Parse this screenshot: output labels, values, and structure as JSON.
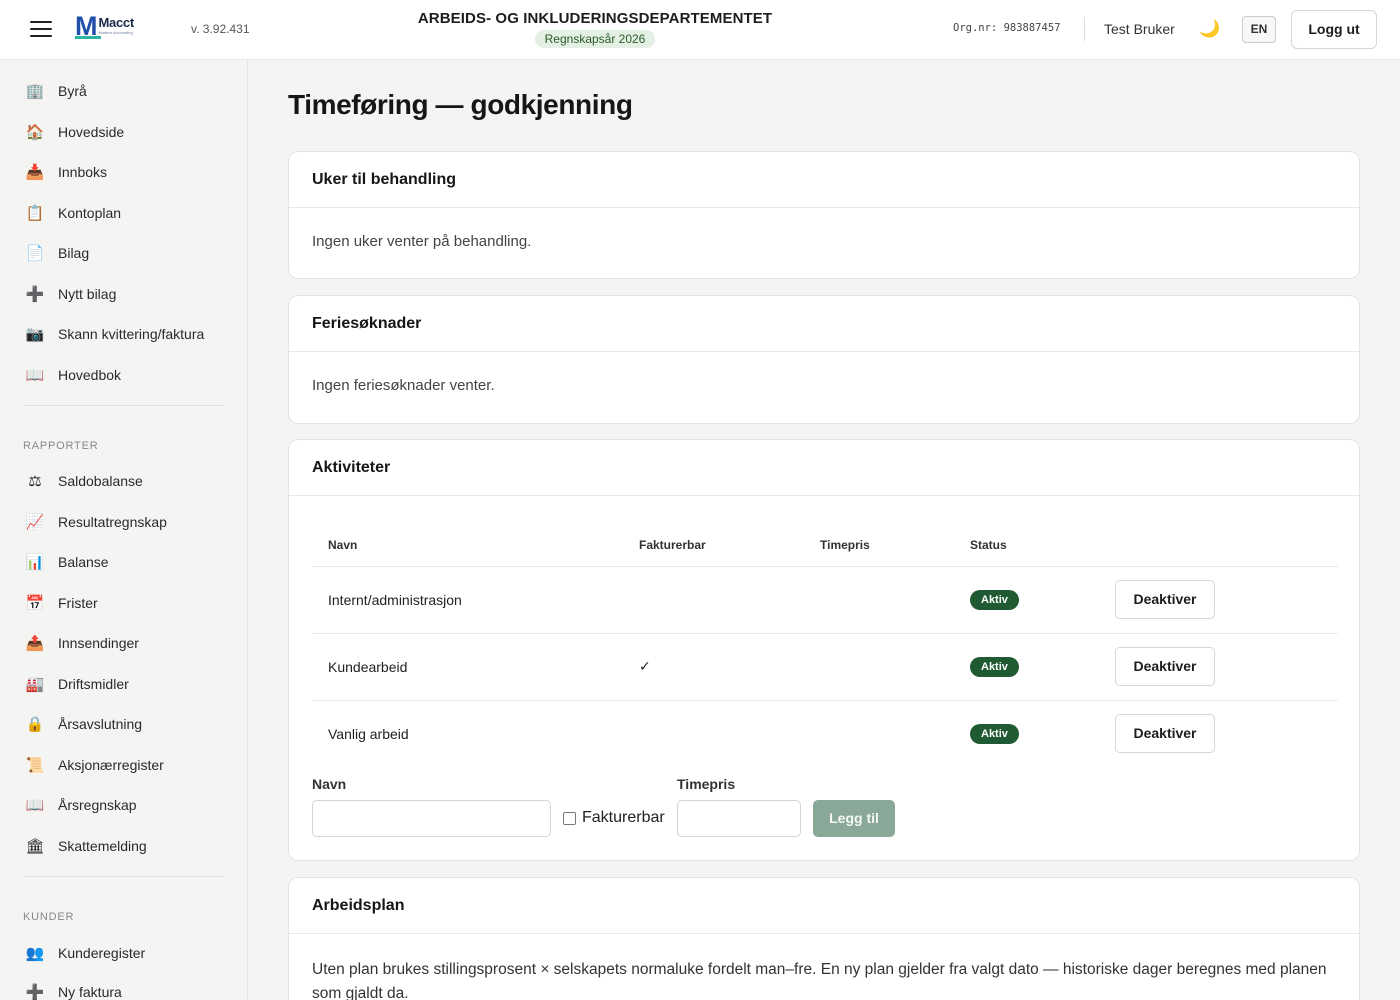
{
  "header": {
    "brand_m": "M",
    "brand_name": "Macct",
    "brand_sub": "Modern Accounting",
    "version": "v. 3.92.431",
    "org_name": "ARBEIDS- OG INKLUDERINGSDEPARTEMENTET",
    "fiscal_year": "Regnskapsår 2026",
    "org_nr": "Org.nr: 983887457",
    "user": "Test Bruker",
    "theme_icon": "🌙",
    "lang": "EN",
    "logout": "Logg ut"
  },
  "sidebar": {
    "main_items": [
      {
        "icon": "🏢",
        "icon_name": "building-icon",
        "label": "Byrå"
      },
      {
        "icon": "🏠",
        "icon_name": "home-icon",
        "label": "Hovedside"
      },
      {
        "icon": "📥",
        "icon_name": "inbox-icon",
        "label": "Innboks"
      },
      {
        "icon": "📋",
        "icon_name": "clipboard-icon",
        "label": "Kontoplan"
      },
      {
        "icon": "📄",
        "icon_name": "document-icon",
        "label": "Bilag"
      },
      {
        "icon": "➕",
        "icon_name": "plus-icon",
        "label": "Nytt bilag"
      },
      {
        "icon": "📷",
        "icon_name": "camera-icon",
        "label": "Skann kvittering/faktura"
      },
      {
        "icon": "📖",
        "icon_name": "book-icon",
        "label": "Hovedbok"
      }
    ],
    "reports_heading": "RAPPORTER",
    "report_items": [
      {
        "icon": "⚖",
        "icon_name": "scale-icon",
        "label": "Saldobalanse"
      },
      {
        "icon": "📈",
        "icon_name": "chart-up-icon",
        "label": "Resultatregnskap"
      },
      {
        "icon": "📊",
        "icon_name": "bar-chart-icon",
        "label": "Balanse"
      },
      {
        "icon": "📅",
        "icon_name": "calendar-icon",
        "label": "Frister"
      },
      {
        "icon": "📤",
        "icon_name": "outbox-icon",
        "label": "Innsendinger"
      },
      {
        "icon": "🏭",
        "icon_name": "factory-icon",
        "label": "Driftsmidler"
      },
      {
        "icon": "🔒",
        "icon_name": "lock-icon",
        "label": "Årsavslutning"
      },
      {
        "icon": "📜",
        "icon_name": "scroll-icon",
        "label": "Aksjonærregister"
      },
      {
        "icon": "📖",
        "icon_name": "book-icon",
        "label": "Årsregnskap"
      },
      {
        "icon": "🏛",
        "icon_name": "bank-icon",
        "label": "Skattemelding"
      }
    ],
    "customers_heading": "KUNDER",
    "customer_items": [
      {
        "icon": "👥",
        "icon_name": "users-icon",
        "label": "Kunderegister"
      },
      {
        "icon": "➕",
        "icon_name": "plus-icon",
        "label": "Ny faktura"
      }
    ]
  },
  "main": {
    "page_title": "Timeføring — godkjenning",
    "weeks": {
      "title": "Uker til behandling",
      "empty": "Ingen uker venter på behandling."
    },
    "vacation": {
      "title": "Feriesøknader",
      "empty": "Ingen feriesøknader venter."
    },
    "activities": {
      "title": "Aktiviteter",
      "columns": [
        "Navn",
        "Fakturerbar",
        "Timepris",
        "Status"
      ],
      "rows": [
        {
          "name": "Internt/administrasjon",
          "billable": "",
          "rate": "",
          "status": "Aktiv",
          "action": "Deaktiver"
        },
        {
          "name": "Kundearbeid",
          "billable": "✓",
          "rate": "",
          "status": "Aktiv",
          "action": "Deaktiver"
        },
        {
          "name": "Vanlig arbeid",
          "billable": "",
          "rate": "",
          "status": "Aktiv",
          "action": "Deaktiver"
        }
      ],
      "form": {
        "name_label": "Navn",
        "name_value": "",
        "billable_label": "Fakturerbar",
        "rate_label": "Timepris",
        "rate_value": "",
        "add_button": "Legg til"
      }
    },
    "work_plan": {
      "title": "Arbeidsplan",
      "description": "Uten plan brukes stillingsprosent × selskapets normaluke fordelt man–fre. En ny plan gjelder fra valgt dato — historiske dager beregnes med planen som gjaldt da."
    }
  }
}
